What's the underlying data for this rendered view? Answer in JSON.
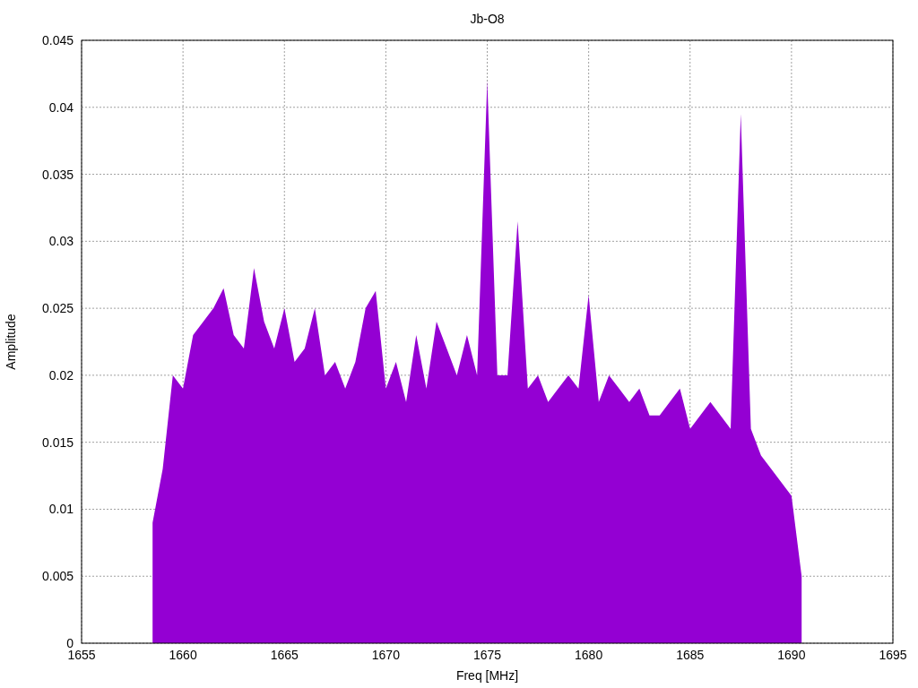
{
  "chart_data": {
    "type": "area",
    "grid": true,
    "title": "Jb-O8",
    "xlabel": "Freq [MHz]",
    "ylabel": "Amplitude",
    "xlim": [
      1655,
      1695
    ],
    "ylim": [
      0,
      0.045
    ],
    "xticks": [
      1655,
      1660,
      1665,
      1670,
      1675,
      1680,
      1685,
      1690,
      1695
    ],
    "yticks": [
      {
        "value": 0,
        "label": "0"
      },
      {
        "value": 0.005,
        "label": "0.005"
      },
      {
        "value": 0.01,
        "label": "0.01"
      },
      {
        "value": 0.015,
        "label": "0.015"
      },
      {
        "value": 0.02,
        "label": "0.02"
      },
      {
        "value": 0.025,
        "label": "0.025"
      },
      {
        "value": 0.03,
        "label": "0.03"
      },
      {
        "value": 0.035,
        "label": "0.035"
      },
      {
        "value": 0.04,
        "label": "0.04"
      },
      {
        "value": 0.045,
        "label": "0.045"
      }
    ],
    "x": [
      1658.5,
      1659,
      1659.5,
      1660,
      1660.5,
      1661,
      1661.5,
      1662,
      1662.5,
      1663,
      1663.5,
      1664,
      1664.5,
      1665,
      1665.5,
      1666,
      1666.5,
      1667,
      1667.5,
      1668,
      1668.5,
      1669,
      1669.5,
      1670,
      1670.5,
      1671,
      1671.5,
      1672,
      1672.5,
      1673,
      1673.5,
      1674,
      1674.5,
      1675,
      1675.5,
      1676,
      1676.5,
      1677,
      1677.5,
      1678,
      1678.5,
      1679,
      1679.5,
      1680,
      1680.5,
      1681,
      1681.5,
      1682,
      1682.5,
      1683,
      1683.5,
      1684,
      1684.5,
      1685,
      1685.5,
      1686,
      1686.5,
      1687,
      1687.5,
      1688,
      1688.5,
      1689,
      1689.5,
      1690,
      1690.5
    ],
    "series": [
      {
        "color": "#9400d3",
        "values": [
          0.009,
          0.013,
          0.02,
          0.019,
          0.023,
          0.024,
          0.025,
          0.0265,
          0.023,
          0.022,
          0.028,
          0.024,
          0.022,
          0.025,
          0.021,
          0.022,
          0.025,
          0.02,
          0.021,
          0.019,
          0.021,
          0.025,
          0.0263,
          0.019,
          0.021,
          0.018,
          0.023,
          0.019,
          0.024,
          0.022,
          0.02,
          0.023,
          0.02,
          0.042,
          0.02,
          0.02,
          0.0315,
          0.019,
          0.02,
          0.018,
          0.019,
          0.02,
          0.019,
          0.026,
          0.018,
          0.02,
          0.019,
          0.018,
          0.019,
          0.017,
          0.017,
          0.018,
          0.019,
          0.016,
          0.017,
          0.018,
          0.017,
          0.016,
          0.0395,
          0.016,
          0.014,
          0.013,
          0.012,
          0.011,
          0.005
        ]
      }
    ]
  }
}
